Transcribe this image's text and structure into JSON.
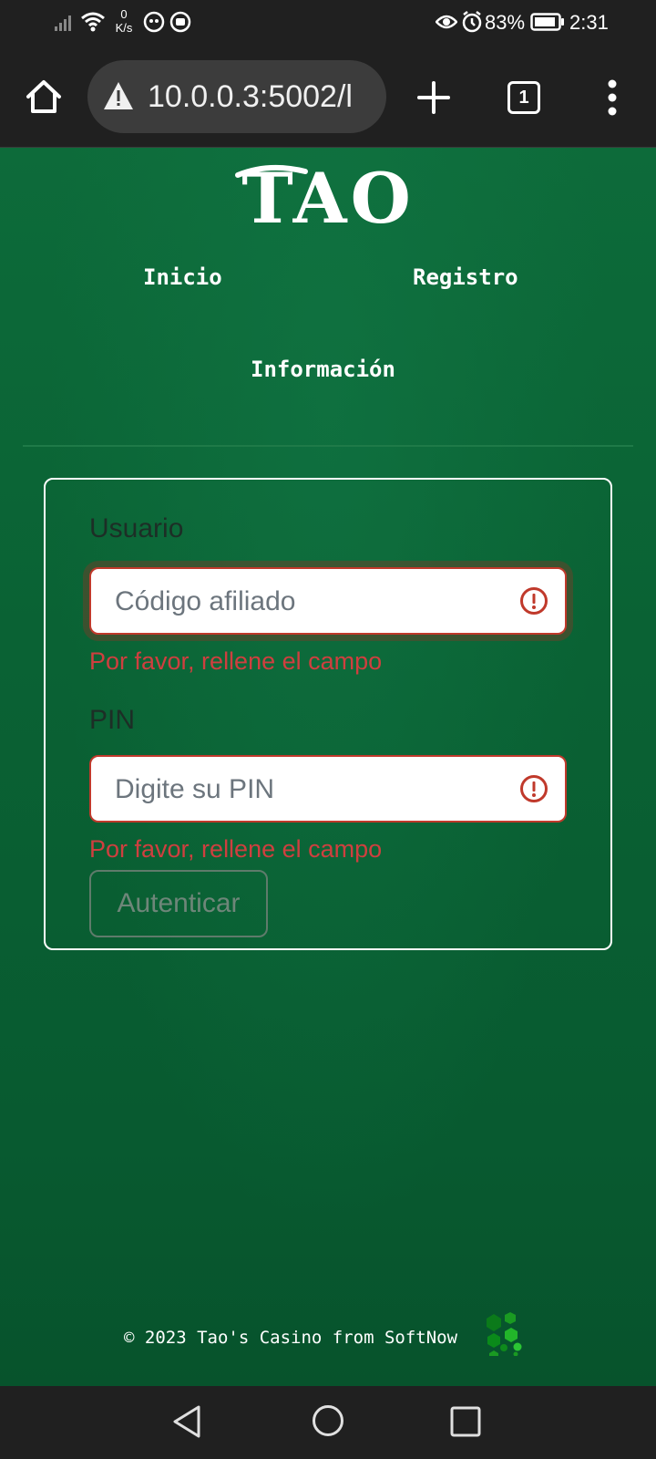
{
  "status_bar": {
    "net_speed_value": "0",
    "net_speed_unit": "K/s",
    "battery_percent": "83%",
    "time": "2:31",
    "icons": [
      "signal-icon",
      "wifi-icon",
      "app-notification-icon",
      "screen-record-icon",
      "eye-comfort-icon",
      "alarm-icon",
      "battery-icon"
    ]
  },
  "browser": {
    "url": "10.0.0.3:5002/l",
    "tab_count": "1",
    "icons": [
      "home-icon",
      "not-secure-warning-icon",
      "new-tab-icon",
      "more-options-icon"
    ]
  },
  "site": {
    "logo_text": "TAO",
    "nav": {
      "inicio": "Inicio",
      "registro": "Registro",
      "informacion": "Información"
    }
  },
  "login_form": {
    "usuario_label": "Usuario",
    "usuario_placeholder": "Código afiliado",
    "usuario_value": "",
    "usuario_error": "Por favor, rellene el campo",
    "pin_label": "PIN",
    "pin_placeholder": "Digite su PIN",
    "pin_value": "",
    "pin_error": "Por favor, rellene el campo",
    "submit_label": "Autenticar"
  },
  "footer": {
    "text": "© 2023 Tao's Casino from SoftNow"
  },
  "colors": {
    "page_background": "#0a6234",
    "error": "#cf3f3f",
    "input_border_error": "#c0392b",
    "status_bar": "#202020"
  }
}
